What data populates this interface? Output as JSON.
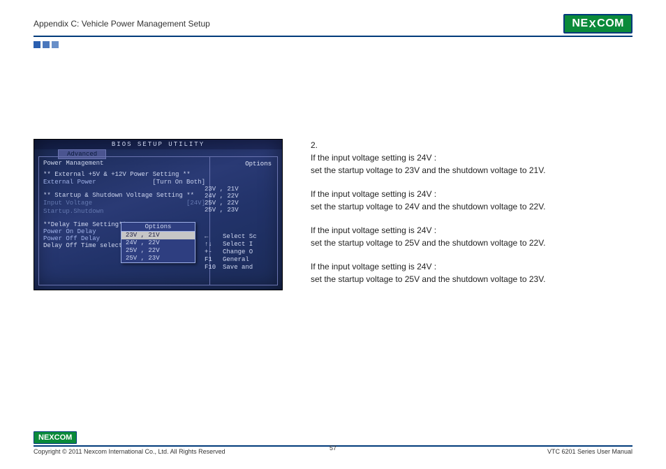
{
  "header": {
    "title": "Appendix C: Vehicle Power Management Setup",
    "logo_text_pre": "NE",
    "logo_text_x": "X",
    "logo_text_post": "COM"
  },
  "bios": {
    "utility_title": "BIOS SETUP UTILITY",
    "tab": "Advanced",
    "panel_heading": "Power Management",
    "right_heading": "Options",
    "sec1_title": "** External +5V & +12V Power Setting **",
    "sec1_item_label": "External Power",
    "sec1_item_value": "[Turn On Both]",
    "sec2_title": "** Startup & Shutdown Voltage Setting **",
    "sec2_item1_label": "Input Voltage",
    "sec2_item1_value": "[24V]",
    "sec2_item2_label": "Startup.Shutdown",
    "sec3_title": "**Delay Time Setting**",
    "sec3_item1": "Power On Delay",
    "sec3_item2": "Power Off Delay",
    "sec3_item3": "Delay Off Time selection",
    "right_opts": [
      "23V , 21V",
      "24V , 22V",
      "25V , 22V",
      "25V , 23V"
    ],
    "popup_title": "Options",
    "popup_items": [
      "23V , 21V",
      "24V , 22V",
      "25V , 22V",
      "25V , 23V"
    ],
    "help": [
      {
        "k": "←",
        "t": "Select Sc"
      },
      {
        "k": "↑↓",
        "t": "Select I"
      },
      {
        "k": "+-",
        "t": "Change O"
      },
      {
        "k": "F1",
        "t": "General"
      },
      {
        "k": "F10",
        "t": "Save and"
      }
    ]
  },
  "body": {
    "step_num": "2.",
    "p1a": "If the input voltage setting is 24V :",
    "p1b": "set the startup voltage to 23V and the shutdown voltage to 21V.",
    "p2a": "If the input voltage setting is 24V :",
    "p2b": "set the startup voltage to 24V and the shutdown voltage to 22V.",
    "p3a": "If the input voltage setting is 24V :",
    "p3b": "set the startup voltage to 25V and the shutdown voltage to 22V.",
    "p4a": "If the input voltage setting is 24V :",
    "p4b": "set the startup voltage to 25V and the shutdown voltage to 23V."
  },
  "footer": {
    "logo_text_pre": "NE",
    "logo_text_x": "X",
    "logo_text_post": "COM",
    "copyright": "Copyright © 2011 Nexcom International Co., Ltd. All Rights Reserved",
    "page_number": "57",
    "manual": "VTC 6201 Series User Manual"
  }
}
